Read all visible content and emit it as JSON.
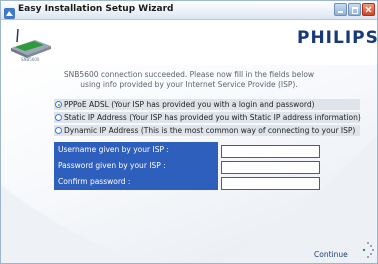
{
  "window": {
    "title": "Easy Installation Setup Wizard",
    "icons": [
      "app-icon",
      "minimize-icon",
      "maximize-icon",
      "close-icon"
    ]
  },
  "header": {
    "device_label": "SNB5600",
    "brand": "PHILIPS"
  },
  "message": {
    "line1": "SNB5600 connection succeeded. Please now fill in the fields below",
    "line2": "using info provided by your Internet Service Provide (ISP)."
  },
  "options": [
    {
      "label": "PPPoE ADSL (Your ISP has provided you with a login and password)",
      "selected": true
    },
    {
      "label": "Static IP Address (Your ISP has provided you with Static IP address information)",
      "selected": false
    },
    {
      "label": "Dynamic IP Address (This is the most common way of connecting to your ISP)",
      "selected": false
    }
  ],
  "form": {
    "username_label": "Username given by your ISP :",
    "username_value": "",
    "password_label": "Password given by your ISP :",
    "password_value": "",
    "confirm_label": "Confirm password :",
    "confirm_value": ""
  },
  "footer": {
    "continue_label": "Continue"
  },
  "colors": {
    "brand": "#16397a",
    "panel": "#2f5fbd",
    "option_bg": "#dfe4ea",
    "message_text": "#5a6473"
  }
}
